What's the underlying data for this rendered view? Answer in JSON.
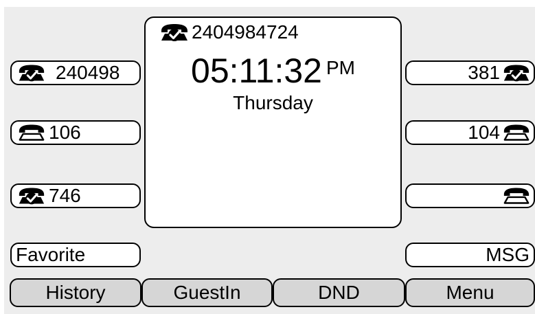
{
  "left_keys": [
    {
      "label": "240498",
      "icon": "phone-registered-icon",
      "filled": true
    },
    {
      "label": "106",
      "icon": "phone-idle-icon",
      "filled": false
    },
    {
      "label": "746",
      "icon": "phone-registered-icon",
      "filled": true
    },
    {
      "label": "Favorite",
      "icon": "",
      "filled": false
    }
  ],
  "right_keys": [
    {
      "label": "381",
      "icon": "phone-registered-icon",
      "filled": true
    },
    {
      "label": "104",
      "icon": "phone-idle-icon",
      "filled": false
    },
    {
      "label": "",
      "icon": "phone-idle-icon",
      "filled": false
    },
    {
      "label": "MSG",
      "icon": "",
      "filled": false
    }
  ],
  "center": {
    "account": "2404984724",
    "time": "05:11:32",
    "ampm": "PM",
    "day": "Thursday"
  },
  "softkeys": [
    "History",
    "GuestIn",
    "DND",
    "Menu"
  ],
  "colors": {
    "screen_bg": "#ededed",
    "softkey_bg": "#d6d6d6",
    "panel_bg": "#ffffff",
    "border": "#000000"
  }
}
